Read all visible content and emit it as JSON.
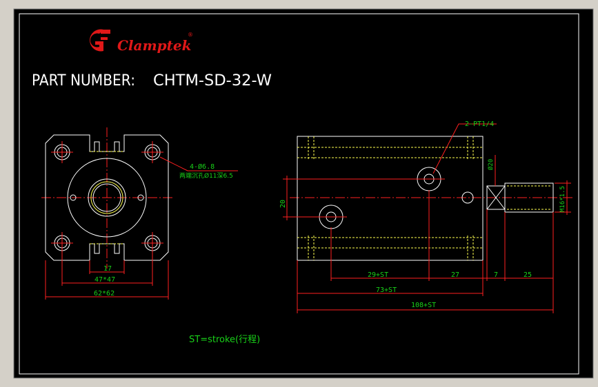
{
  "logo": {
    "brand": "Clamptek",
    "registered_mark": "®"
  },
  "part": {
    "label": "PART NUMBER:",
    "number": "CHTM-SD-32-W"
  },
  "front_view": {
    "hole_callout_line1": "4-Ø6.8",
    "hole_callout_line2": "两端沉孔Ø11深6.5",
    "dim_slot": "17",
    "dim_hole_pitch": "47*47",
    "dim_body": "62*62"
  },
  "side_view": {
    "port_callout": "2-PT1/4",
    "dim_port_offset": "20",
    "dim_rod_dia": "Ø20",
    "dim_thread": "M16*1.5",
    "dim_stroke_a": "29+ST",
    "dim_27": "27",
    "dim_7": "7",
    "dim_25": "25",
    "dim_body_len": "73+ST",
    "dim_total": "108+ST"
  },
  "note": "ST=stroke(行程)",
  "colors": {
    "frame": "#000000",
    "border": "#ffffff",
    "outline": "#ffffff",
    "dimension": "#ff2020",
    "text_green": "#19d219",
    "centerline": "#ff2020",
    "logo_red": "#e01818",
    "hidden_line": "#ffff50"
  }
}
